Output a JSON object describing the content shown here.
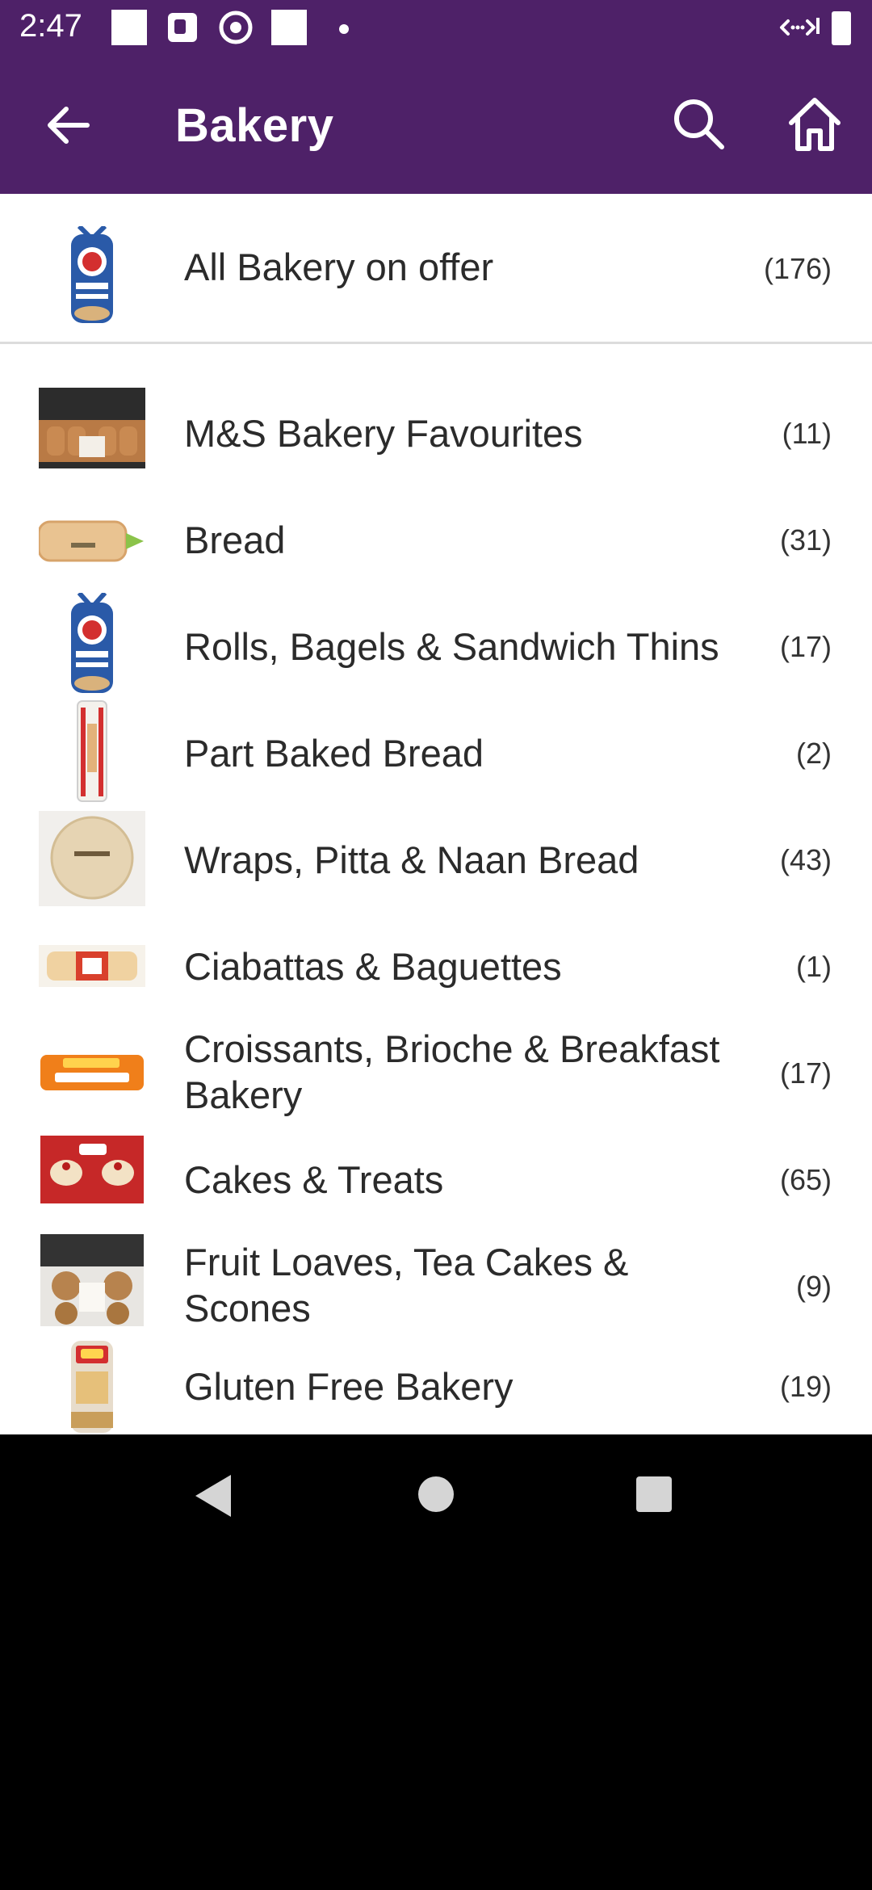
{
  "status_bar": {
    "time": "2:47"
  },
  "app_bar": {
    "title": "Bakery",
    "back_icon": "arrow-left-icon",
    "search_icon": "search-icon",
    "home_icon": "home-icon"
  },
  "all_offer": {
    "label": "All Bakery on offer",
    "count": "(176)",
    "thumb_icon": "bagels-bag-thumbnail"
  },
  "categories": [
    {
      "label": "M&S Bakery Favourites",
      "count": "(11)",
      "thumb": "hot-cross-buns-thumbnail"
    },
    {
      "label": "Bread",
      "count": "(31)",
      "thumb": "sliced-loaf-thumbnail"
    },
    {
      "label": "Rolls, Bagels & Sandwich Thins",
      "count": "(17)",
      "thumb": "bagels-bag-thumbnail"
    },
    {
      "label": "Part Baked Bread",
      "count": "(2)",
      "thumb": "baguette-pack-thumbnail"
    },
    {
      "label": "Wraps, Pitta & Naan Bread",
      "count": "(43)",
      "thumb": "tortilla-thumbnail"
    },
    {
      "label": "Ciabattas & Baguettes",
      "count": "(1)",
      "thumb": "ciabatta-thumbnail"
    },
    {
      "label": "Croissants, Brioche & Breakfast Bakery",
      "count": "(17)",
      "thumb": "crumpets-thumbnail"
    },
    {
      "label": "Cakes & Treats",
      "count": "(65)",
      "thumb": "cherry-bakewells-thumbnail"
    },
    {
      "label": "Fruit Loaves, Tea Cakes & Scones",
      "count": "(9)",
      "thumb": "teacakes-thumbnail"
    },
    {
      "label": "Gluten Free Bakery",
      "count": "(19)",
      "thumb": "gluten-free-bread-thumbnail"
    }
  ],
  "colors": {
    "brand_purple": "#4e2168",
    "text": "#2b2b2b",
    "divider": "#dcdcdc"
  }
}
